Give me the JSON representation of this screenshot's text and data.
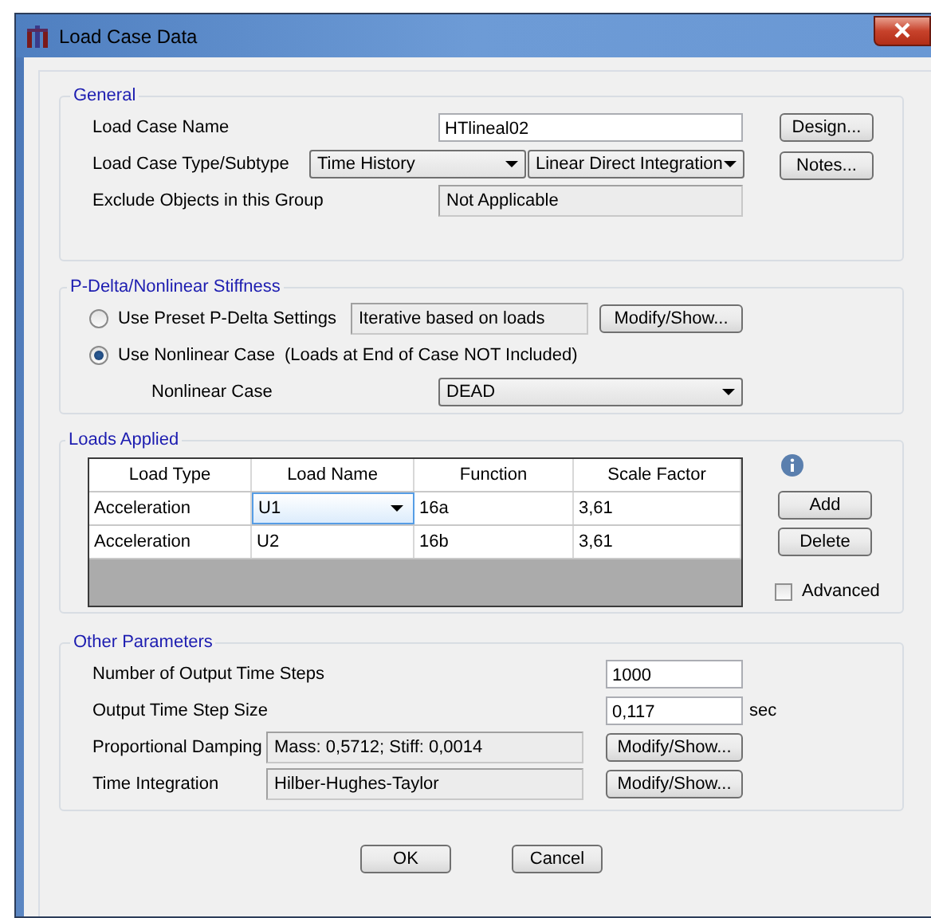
{
  "window": {
    "title": "Load Case Data"
  },
  "general": {
    "title": "General",
    "fields": [
      {
        "kind": "text",
        "label": "Load Case Name",
        "value": "HTlineal02"
      },
      {
        "kind": "selects",
        "label": "Load Case Type/Subtype",
        "values": [
          "Time History",
          "Linear Direct Integration"
        ]
      },
      {
        "kind": "readonly",
        "label": "Exclude Objects in this Group",
        "value": "Not Applicable"
      }
    ],
    "buttons": [
      "Design...",
      "Notes..."
    ]
  },
  "pdelta": {
    "title": "P-Delta/Nonlinear Stiffness",
    "options": [
      {
        "label": "Use Preset P-Delta Settings",
        "selected": false,
        "value": "Iterative based on loads",
        "button": "Modify/Show..."
      },
      {
        "label": "Use Nonlinear Case",
        "note": "(Loads at End of Case NOT Included)",
        "selected": true
      }
    ],
    "nonlinear_case": {
      "label": "Nonlinear Case",
      "value": "DEAD"
    }
  },
  "loads": {
    "title": "Loads Applied",
    "columns": [
      "Load Type",
      "Load Name",
      "Function",
      "Scale Factor"
    ],
    "rows": [
      {
        "cells": [
          "Acceleration",
          "U1",
          "16a",
          "3,61"
        ],
        "editing": true
      },
      {
        "cells": [
          "Acceleration",
          "U2",
          "16b",
          "3,61"
        ],
        "editing": false
      }
    ],
    "buttons": [
      "Add",
      "Delete"
    ],
    "advanced": {
      "label": "Advanced",
      "checked": false
    }
  },
  "other": {
    "title": "Other Parameters",
    "fields": [
      {
        "kind": "text",
        "label": "Number of Output Time Steps",
        "value": "1000"
      },
      {
        "kind": "text",
        "label": "Output Time Step Size",
        "value": "0,117",
        "unit": "sec"
      },
      {
        "kind": "readonly",
        "label": "Proportional Damping",
        "value": "Mass: 0,5712; Stiff: 0,0014",
        "button": "Modify/Show..."
      },
      {
        "kind": "readonly",
        "label": "Time Integration",
        "value": "Hilber-Hughes-Taylor",
        "button": "Modify/Show..."
      }
    ]
  },
  "buttons": [
    "OK",
    "Cancel"
  ]
}
